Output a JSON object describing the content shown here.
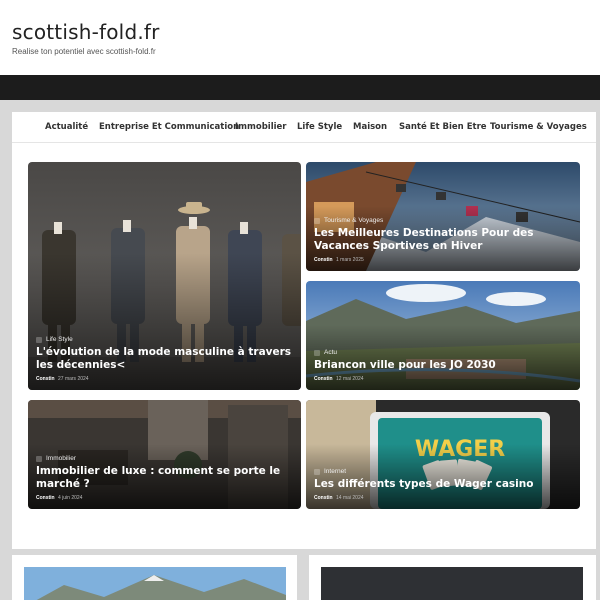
{
  "site": {
    "title": "scottish-fold.fr",
    "tagline": "Realise ton potentiel avec scottish-fold.fr"
  },
  "nav": {
    "items": [
      "Actualité",
      "Entreprise Et Communication",
      "Immobilier",
      "Life Style",
      "Maison",
      "Santé Et Bien Etre",
      "Tourisme & Voyages"
    ]
  },
  "posts": [
    {
      "category": "Life Style",
      "title": "L'évolution de la mode masculine à travers les décennies<",
      "author": "Constin",
      "date": "27 mars 2024"
    },
    {
      "category": "Tourisme & Voyages",
      "title": "Les Meilleures Destinations Pour des Vacances Sportives en Hiver",
      "author": "Constin",
      "date": "1 mars 2025"
    },
    {
      "category": "Actu",
      "title": "Briancon ville pour les JO 2030",
      "author": "Constin",
      "date": "12 mai 2024"
    },
    {
      "category": "Immobilier",
      "title": "Immobilier de luxe : comment se porte le marché ?",
      "author": "Constin",
      "date": "4 juin 2024"
    },
    {
      "category": "Internet",
      "title": "Les différents types de Wager casino",
      "author": "Constin",
      "date": "14 mai 2024"
    }
  ],
  "images": {
    "wager_sign": "WAGER"
  },
  "colors": {
    "topbar": "#1c1c1c",
    "page_bg": "#d8d8d8",
    "nav_text": "#333333"
  }
}
